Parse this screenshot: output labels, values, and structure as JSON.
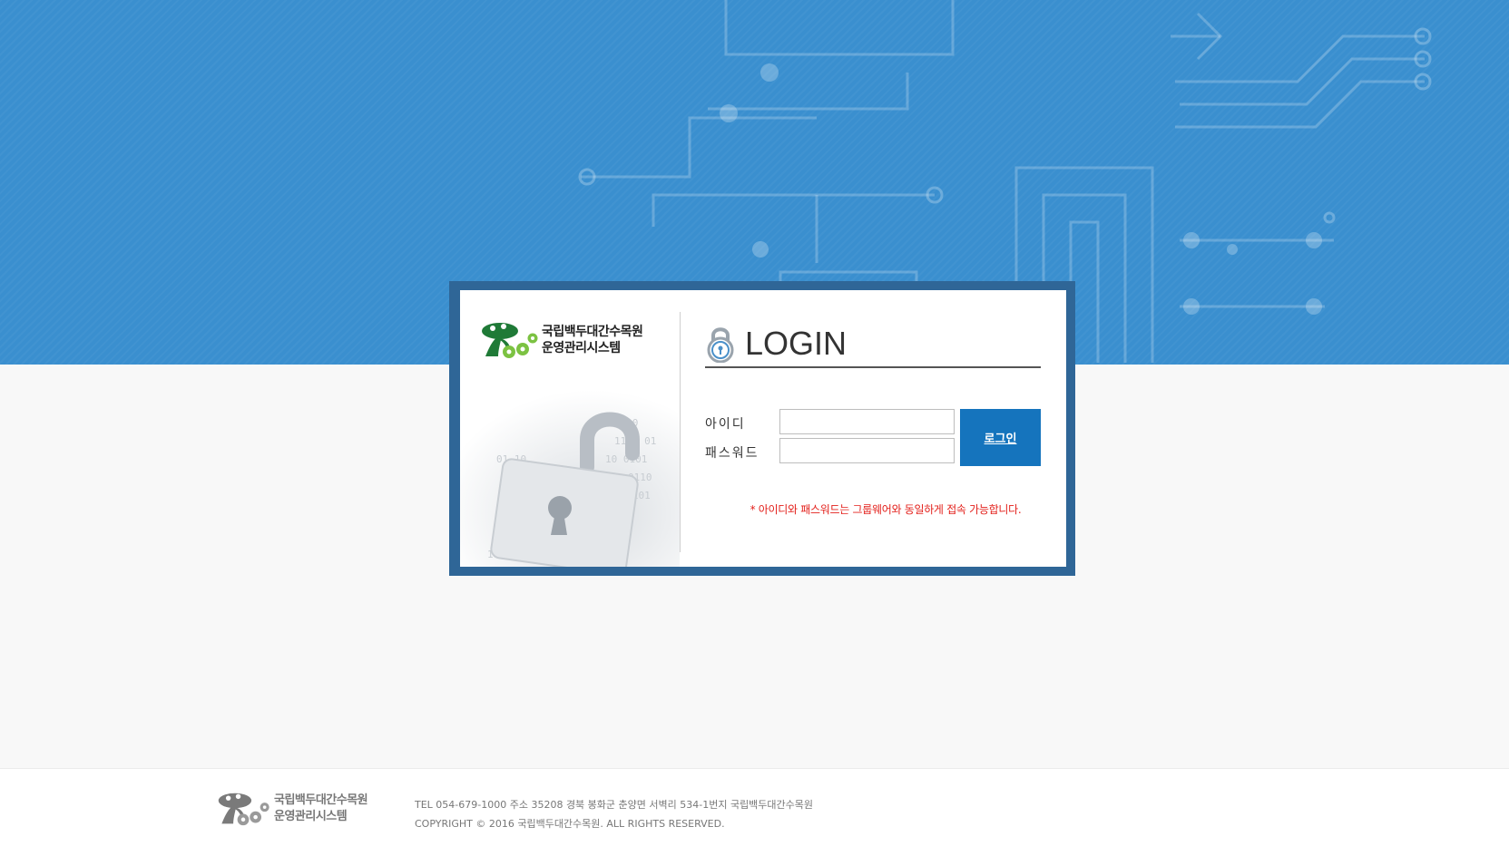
{
  "colors": {
    "hero_bg": "#3a8fcf",
    "frame": "#2f6697",
    "login_button": "#1574bd",
    "notice_text": "#e3201b",
    "logo_green": "#1f7a37",
    "logo_light_green": "#7cc242"
  },
  "brand": {
    "org_name": "국립백두대간수목원",
    "system_name": "운영관리시스템"
  },
  "login": {
    "title": "LOGIN",
    "id_label": "아이디",
    "password_label": "패스워드",
    "id_value": "",
    "password_value": "",
    "button_label": "로그인",
    "notice": "* 아이디와 패스워드는 그룹웨어와 동일하게 접속 가능합니다."
  },
  "footer": {
    "org_name": "국립백두대간수목원",
    "system_name": "운영관리시스템",
    "contact": "TEL 054-679-1000 주소 35208 경북 봉화군 춘양면 서벽리 534-1번지 국립백두대간수목원",
    "copyright": "COPYRIGHT © 2016 국립백두대간수목원. ALL RIGHTS RESERVED."
  },
  "icons": {
    "logo": "tree-logo-icon",
    "login_lock": "padlock-icon",
    "decor_lock": "unlocked-padlock-icon"
  }
}
